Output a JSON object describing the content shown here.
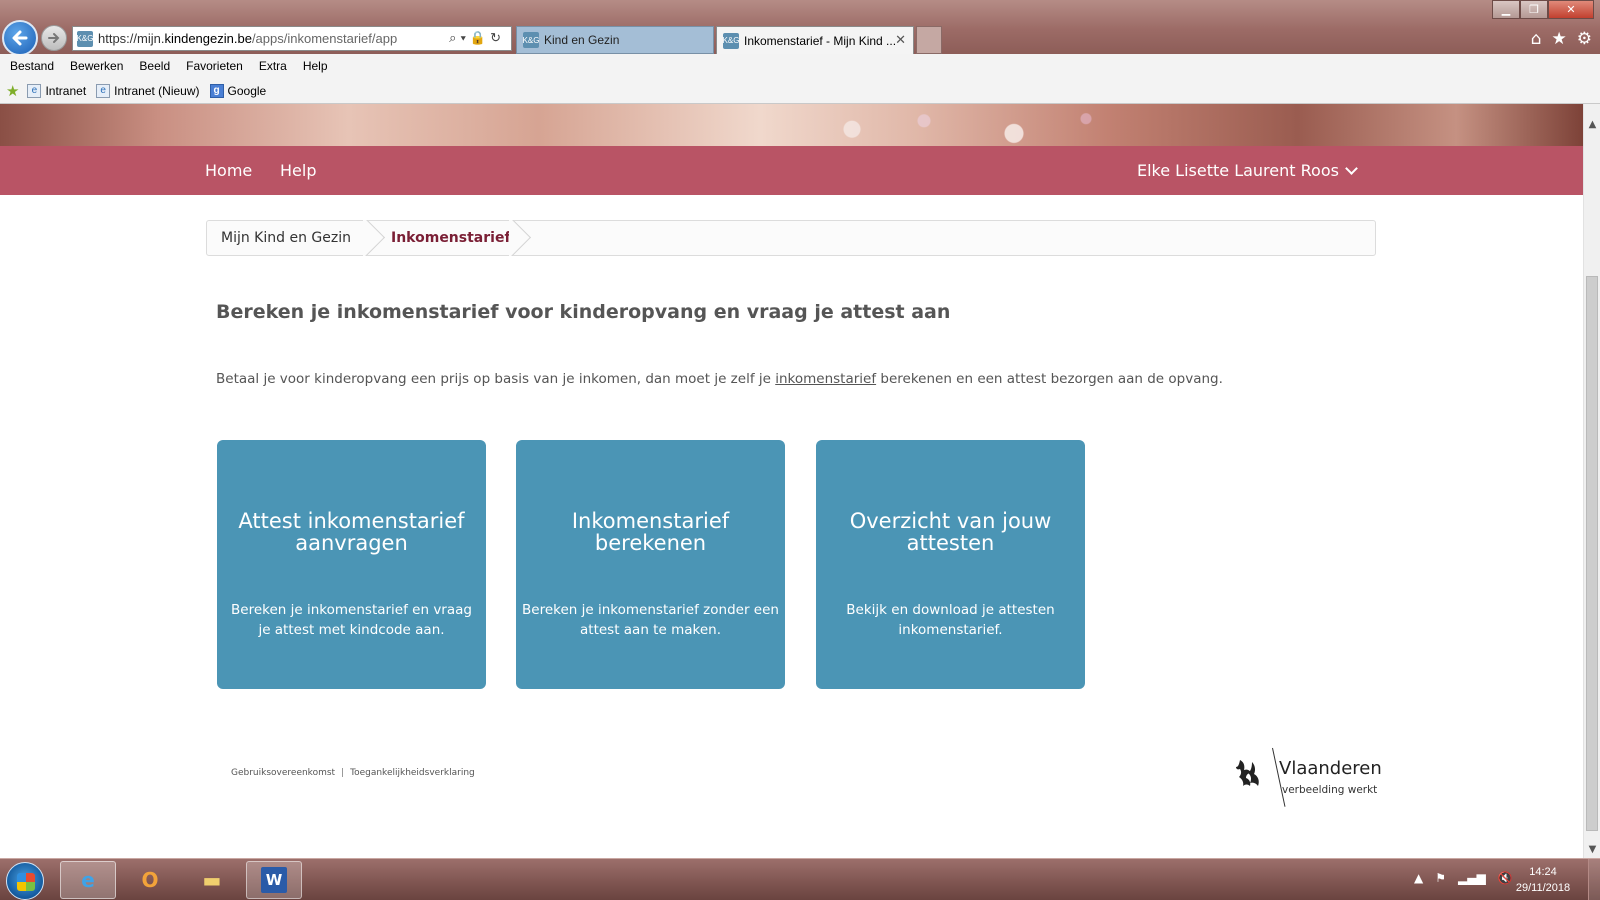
{
  "browser": {
    "address": {
      "prefix": "https://mijn.",
      "host": "kindengezin.be",
      "path": "/apps/inkomenstarief/app"
    },
    "tabs": [
      {
        "label": "Kind en Gezin",
        "active": false
      },
      {
        "label": "Inkomenstarief - Mijn Kind ...",
        "active": true
      }
    ],
    "menu": [
      "Bestand",
      "Bewerken",
      "Beeld",
      "Favorieten",
      "Extra",
      "Help"
    ],
    "favorites": [
      "Intranet",
      "Intranet (Nieuw)",
      "Google"
    ]
  },
  "site": {
    "nav": {
      "home": "Home",
      "help": "Help",
      "user": "Elke Lisette Laurent Roos"
    },
    "breadcrumb": [
      "Mijn Kind en Gezin",
      "Inkomenstarief"
    ],
    "title": "Bereken je inkomenstarief voor kinderopvang en vraag je attest aan",
    "intro": {
      "before": "Betaal je voor kinderopvang een prijs op basis van je inkomen, dan moet je zelf je ",
      "link": "inkomenstarief",
      "after": " berekenen en een attest bezorgen aan de opvang."
    },
    "cards": [
      {
        "title": "Attest inkomenstarief aanvragen",
        "text": "Bereken je inkomenstarief en vraag je attest met kindcode aan."
      },
      {
        "title": "Inkomenstarief berekenen",
        "text": "Bereken je inkomenstarief zonder een attest aan te maken."
      },
      {
        "title": "Overzicht van jouw attesten",
        "text": "Bekijk en download je attesten inkomenstarief."
      }
    ],
    "footer": {
      "links": [
        "Gebruiksovereenkomst",
        "Toegankelijkheidsverklaring"
      ],
      "separator": "|"
    },
    "logo": {
      "name": "Vlaanderen",
      "tagline": "verbeelding werkt"
    }
  },
  "taskbar": {
    "time": "14:24",
    "date": "29/11/2018"
  },
  "colors": {
    "nav": "#b95465",
    "card": "#4b95b5",
    "breadcrumb_active": "#7a1f35"
  }
}
